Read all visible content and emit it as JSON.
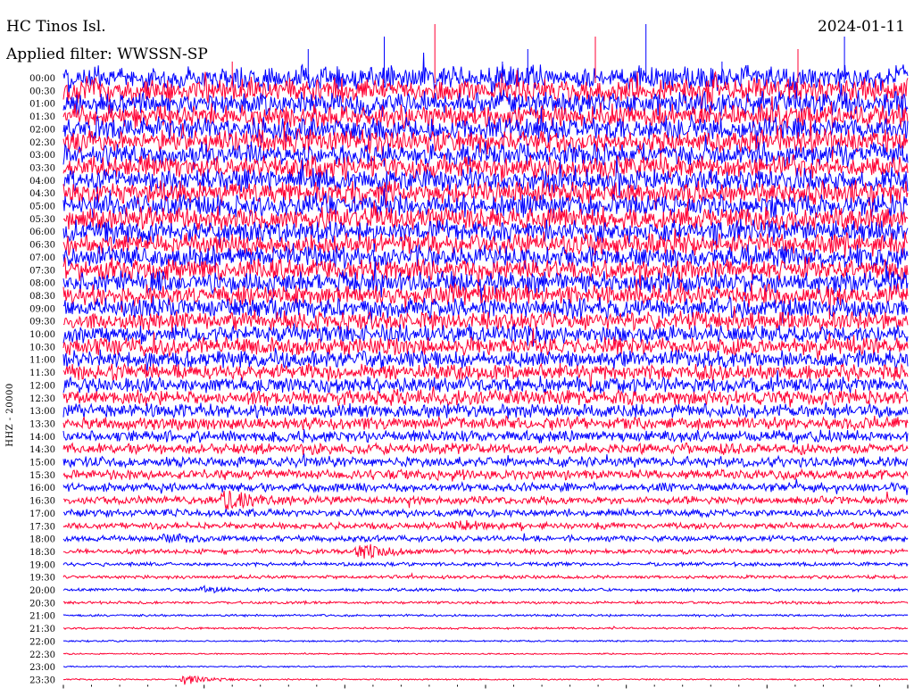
{
  "header": {
    "station": "HC Tinos Isl.",
    "filter": "Applied filter: WWSSN-SP",
    "date": "2024-01-11"
  },
  "colors": {
    "trace_a": "#0000ff",
    "trace_b": "#ff0033",
    "background": "#ffffff",
    "text": "#000000"
  },
  "chart_data": {
    "type": "line",
    "title": "HC Tinos Isl.",
    "subtitle": "Applied filter: WWSSN-SP",
    "ylabel": "HHZ - 20000",
    "row_labels": [
      "00:00",
      "00:30",
      "01:00",
      "01:30",
      "02:00",
      "02:30",
      "03:00",
      "03:30",
      "04:00",
      "04:30",
      "05:00",
      "05:30",
      "06:00",
      "06:30",
      "07:00",
      "07:30",
      "08:00",
      "08:30",
      "09:00",
      "09:30",
      "10:00",
      "10:30",
      "11:00",
      "11:30",
      "12:00",
      "12:30",
      "13:00",
      "13:30",
      "14:00",
      "14:30",
      "15:00",
      "15:30",
      "16:00",
      "16:30",
      "17:00",
      "17:30",
      "18:00",
      "18:30",
      "19:00",
      "19:30",
      "20:00",
      "20:30",
      "21:00",
      "21:30",
      "22:00",
      "22:30",
      "23:00",
      "23:30"
    ],
    "row_colors": [
      "blue",
      "red"
    ],
    "noise_amplitude": [
      1.0,
      0.98,
      0.97,
      0.96,
      0.95,
      0.95,
      0.94,
      0.94,
      0.93,
      0.93,
      0.92,
      0.92,
      0.92,
      0.91,
      0.9,
      0.89,
      0.88,
      0.86,
      0.84,
      0.8,
      0.74,
      0.72,
      0.7,
      0.67,
      0.64,
      0.62,
      0.58,
      0.52,
      0.48,
      0.44,
      0.42,
      0.4,
      0.36,
      0.33,
      0.3,
      0.27,
      0.24,
      0.2,
      0.16,
      0.14,
      0.12,
      0.11,
      0.09,
      0.08,
      0.07,
      0.06,
      0.06,
      0.06
    ],
    "events": [
      {
        "row": "16:30",
        "minute": 5.7,
        "strength": 14
      },
      {
        "row": "18:30",
        "minute": 10.5,
        "strength": 10
      },
      {
        "row": "18:00",
        "minute": 3.6,
        "strength": 6
      },
      {
        "row": "20:00",
        "minute": 5.0,
        "strength": 4
      },
      {
        "row": "23:30",
        "minute": 4.3,
        "strength": 7
      },
      {
        "row": "17:30",
        "minute": 14.0,
        "strength": 5
      }
    ],
    "grid": false,
    "legend": "none"
  }
}
